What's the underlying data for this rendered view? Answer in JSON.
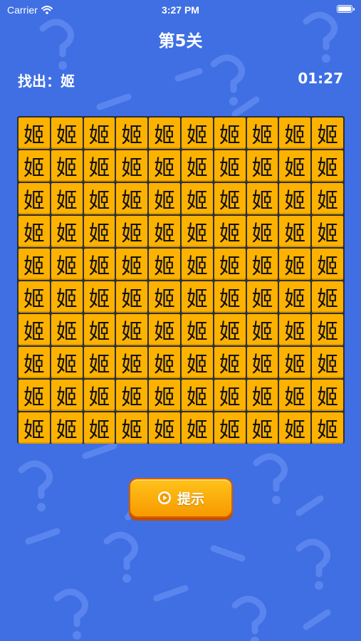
{
  "status_bar": {
    "carrier": "Carrier",
    "time": "3:27 PM"
  },
  "level": {
    "title": "第5关"
  },
  "game": {
    "find_label": "找出：姬",
    "timer": "01:27",
    "tile_char": "姬",
    "rows": 10,
    "cols": 10
  },
  "hint_button": {
    "label": "提示",
    "icon": "play-circle-icon"
  },
  "colors": {
    "background": "#3f6fe3",
    "tile": "#fdb200",
    "button": "#ffb00f",
    "button_border": "#d65d00"
  }
}
